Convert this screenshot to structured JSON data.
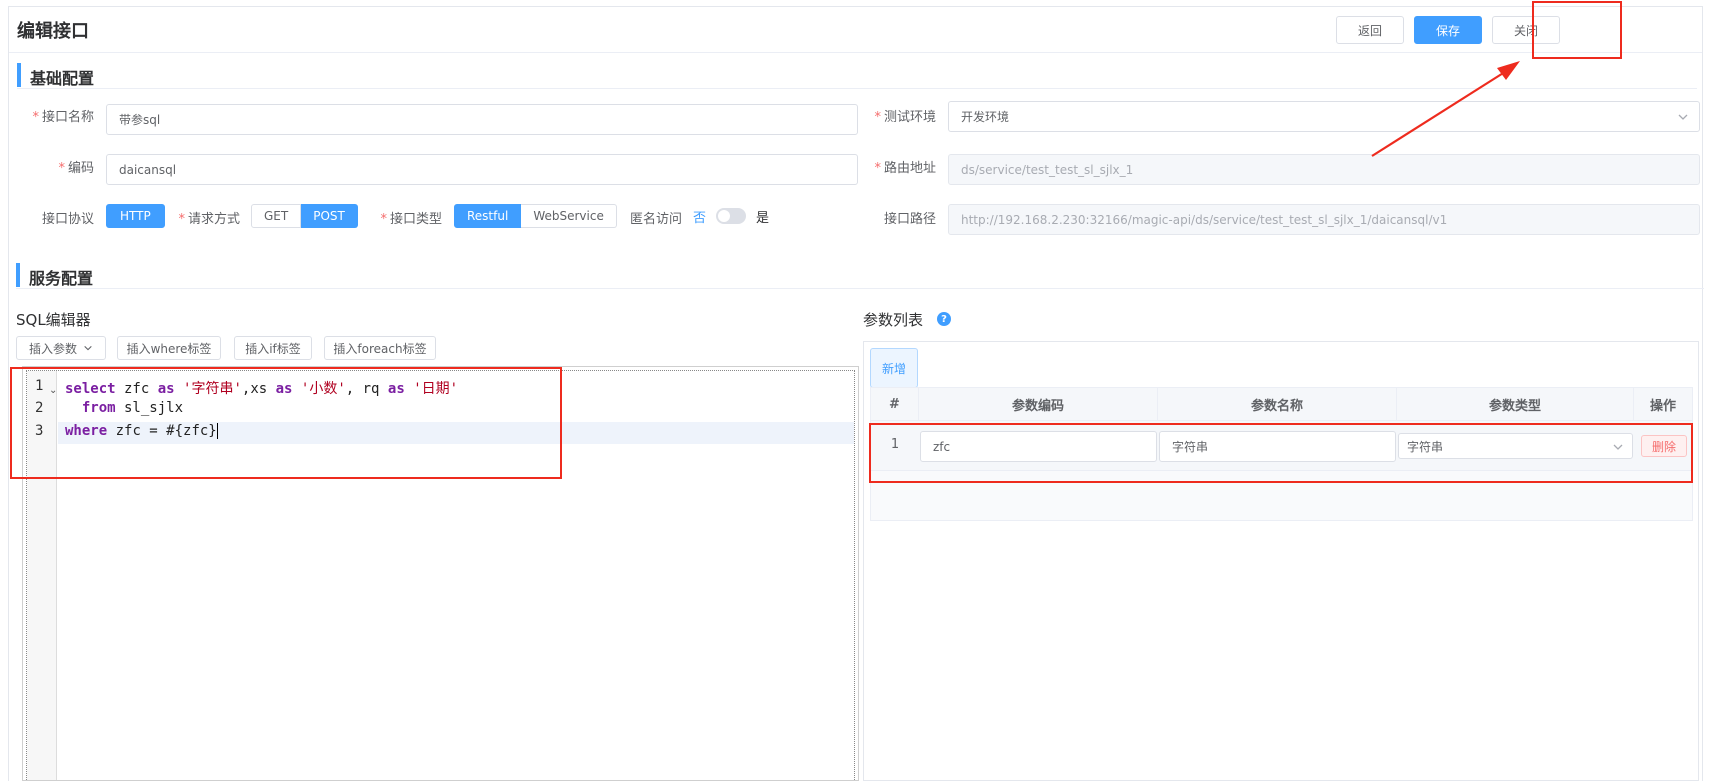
{
  "header": {
    "title": "编辑接口",
    "back_label": "返回",
    "save_label": "保存",
    "close_label": "关闭"
  },
  "sections": {
    "basic": "基础配置",
    "service": "服务配置"
  },
  "form": {
    "name_label": "接口名称",
    "name_value": "带参sql",
    "code_label": "编码",
    "code_value": "daicansql",
    "env_label": "测试环境",
    "env_value": "开发环境",
    "route_label": "路由地址",
    "route_value": "ds/service/test_test_sl_sjlx_1",
    "path_label": "接口路径",
    "path_value": "http://192.168.2.230:32166/magic-api/ds/service/test_test_sl_sjlx_1/daicansql/v1",
    "protocol_label": "接口协议",
    "protocol_value": "HTTP",
    "method_label": "请求方式",
    "method_options": [
      "GET",
      "POST"
    ],
    "method_selected": "POST",
    "type_label": "接口类型",
    "type_options": [
      "Restful",
      "WebService"
    ],
    "type_selected": "Restful",
    "anon_label": "匿名访问",
    "anon_off": "否",
    "anon_on": "是"
  },
  "sql_editor": {
    "title": "SQL编辑器",
    "insert_param": "插入参数",
    "insert_where": "插入where标签",
    "insert_if": "插入if标签",
    "insert_foreach": "插入foreach标签",
    "line_numbers": [
      "1",
      "2",
      "3"
    ],
    "line1": {
      "kw1": "select",
      "t1": " zfc ",
      "kw2": "as",
      "s1": " '字符串'",
      "t2": ",xs ",
      "kw3": "as",
      "s2": " '小数'",
      "t3": ", rq ",
      "kw4": "as",
      "s3": " '日期'"
    },
    "line2": {
      "indent": "  ",
      "kw1": "from",
      "t1": " sl_sjlx"
    },
    "line3": {
      "kw1": "where",
      "t1": " zfc = #{zfc}"
    }
  },
  "params": {
    "title": "参数列表",
    "help": "?",
    "add_label": "新增",
    "columns": [
      "#",
      "参数编码",
      "参数名称",
      "参数类型",
      "操作"
    ],
    "rows": [
      {
        "index": "1",
        "code": "zfc",
        "name": "字符串",
        "type": "字符串",
        "delete": "删除"
      }
    ]
  },
  "colors": {
    "primary": "#409eff",
    "annotation": "#ee2b1e",
    "danger": "#f56c6c"
  }
}
